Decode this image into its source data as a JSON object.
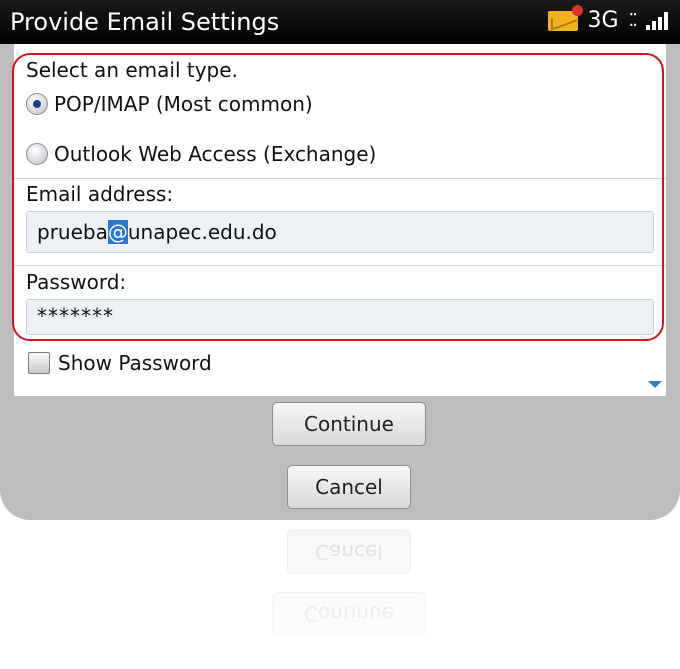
{
  "titlebar": {
    "title": "Provide Email Settings",
    "network": "3G",
    "icons": [
      "mail-notification-icon",
      "bbm-icon",
      "signal-icon"
    ]
  },
  "form": {
    "email_type_label": "Select an email type.",
    "options": [
      {
        "label": "POP/IMAP (Most common)",
        "selected": true
      },
      {
        "label": "Outlook Web Access (Exchange)",
        "selected": false
      }
    ],
    "email_label": "Email address:",
    "email_value_before_caret": "prueba",
    "email_value_caret": "@",
    "email_value_after_caret": "unapec.edu.do",
    "password_label": "Password:",
    "password_value": "*******",
    "show_password_label": "Show Password",
    "show_password_checked": false
  },
  "buttons": {
    "continue": "Continue",
    "cancel": "Cancel"
  },
  "colors": {
    "highlight": "#d4141c",
    "caret": "#2a78d6",
    "titlebar": "#000000"
  }
}
